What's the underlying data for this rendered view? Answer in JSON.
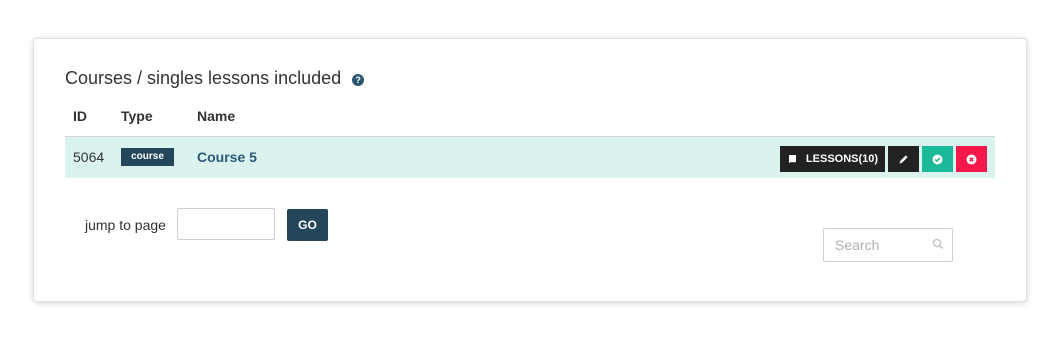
{
  "panel": {
    "title": "Courses / singles lessons included",
    "help_icon": "question-circle-icon"
  },
  "table": {
    "columns": [
      "ID",
      "Type",
      "Name"
    ],
    "rows": [
      {
        "id": "5064",
        "type": "course",
        "name": "Course 5",
        "actions": {
          "lessons_label": "LESSONS(10)",
          "lessons_icon": "book-icon",
          "edit_icon": "pencil-icon",
          "approve_icon": "check-circle-icon",
          "delete_icon": "times-circle-icon"
        }
      }
    ]
  },
  "pagination": {
    "jump_label": "jump to page",
    "page_value": "",
    "go_label": "GO"
  },
  "search": {
    "placeholder": "Search",
    "icon": "search-icon"
  },
  "colors": {
    "row_highlight": "#dbf3ef",
    "primary_dark": "#23465b",
    "link": "#2b5a78",
    "approve": "#19b99a",
    "delete": "#f5184a",
    "action_dark": "#222222"
  }
}
